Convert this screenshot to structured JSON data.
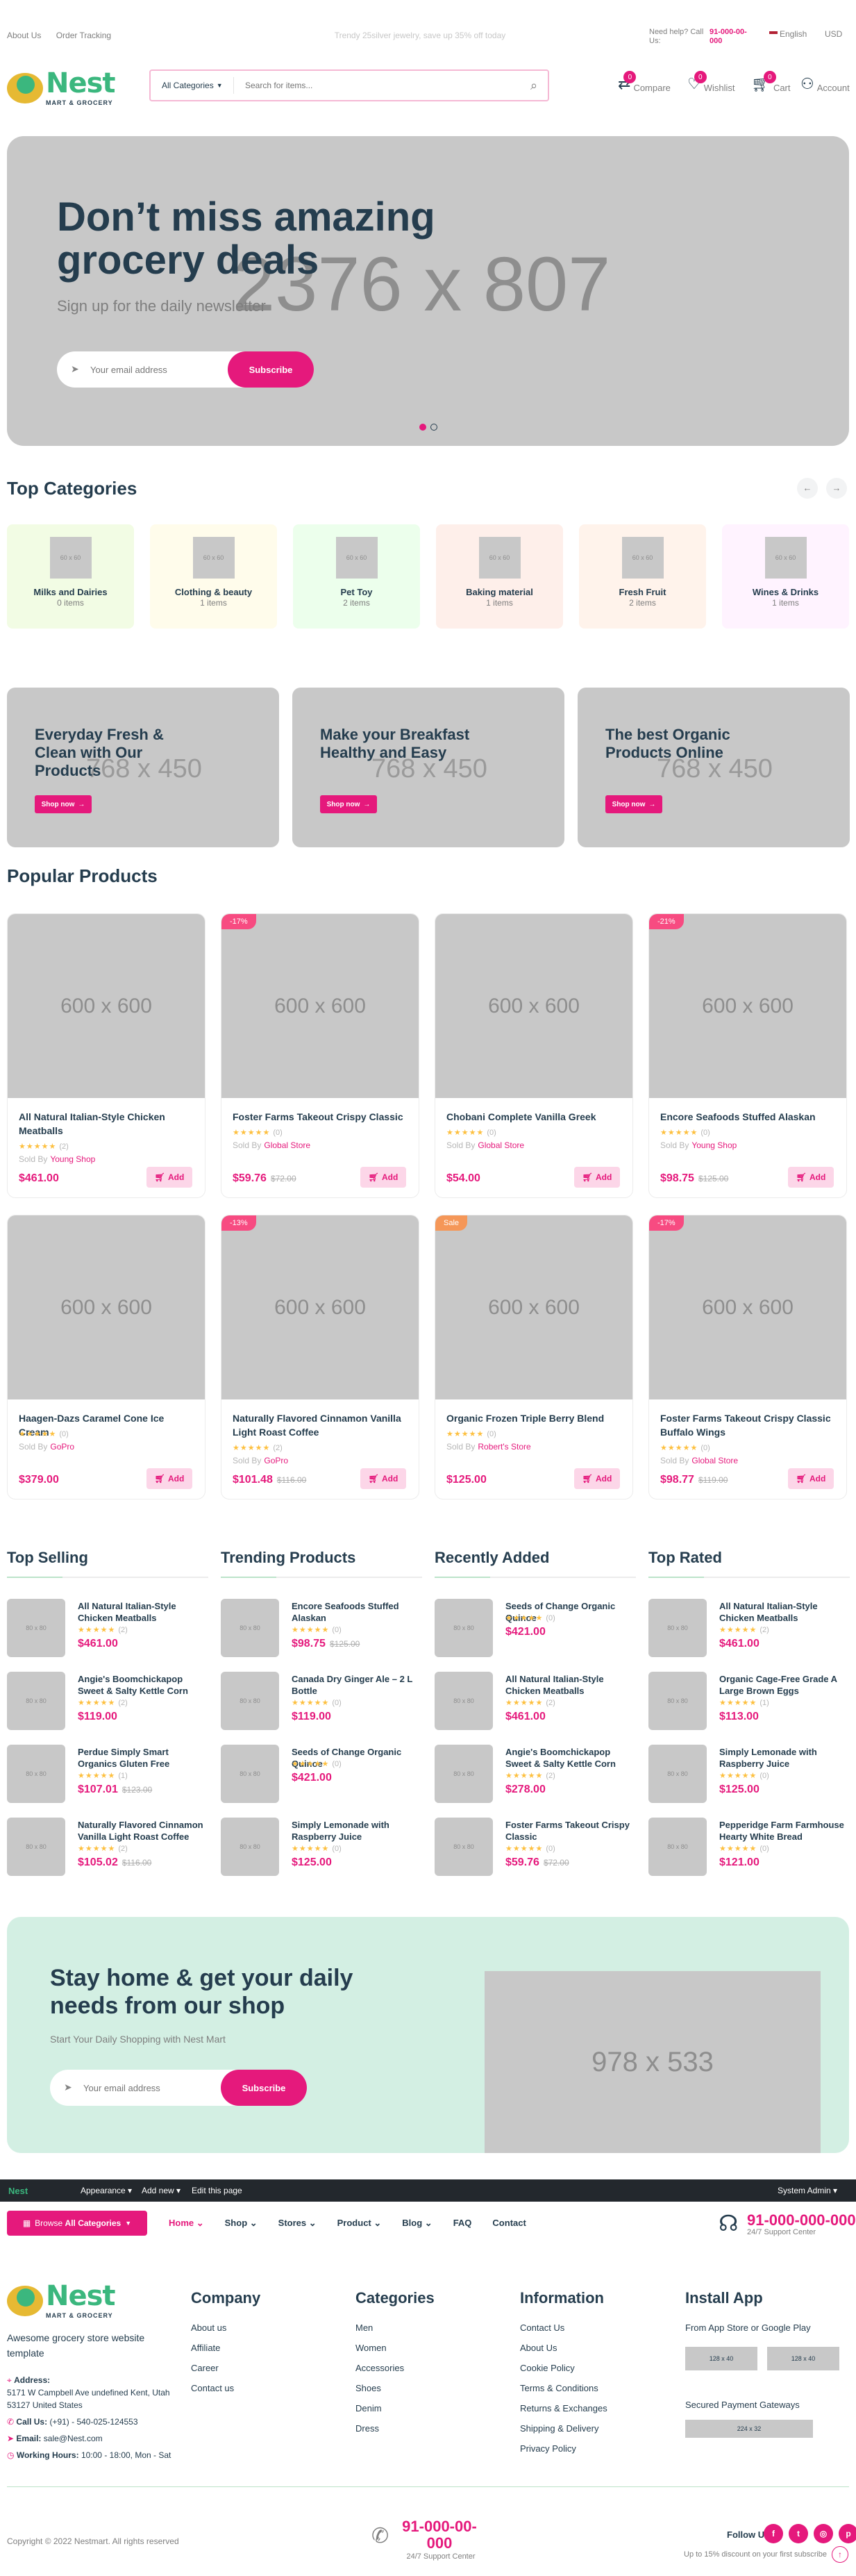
{
  "topbar": {
    "links": [
      "About Us",
      "Order Tracking"
    ],
    "promo": "Trendy 25silver jewelry, save up 35% off today",
    "help_label": "Need help? Call Us:",
    "help_phone": "91-000-00-000",
    "language": "English",
    "currency": "USD"
  },
  "header": {
    "logo_name": "Nest",
    "logo_tag": "MART & GROCERY",
    "category_select": "All Categories",
    "search_placeholder": "Search for items...",
    "compare": {
      "label": "Compare",
      "count": "0"
    },
    "wishlist": {
      "label": "Wishlist",
      "count": "0"
    },
    "cart": {
      "label": "Cart",
      "count": "0"
    },
    "account": "Account"
  },
  "hero": {
    "placeholder_text": "2376 x 807",
    "title_line1": "Don’t miss amazing",
    "title_line2": "grocery deals",
    "subtitle": "Sign up for the daily newsletter",
    "email_placeholder": "Your email address",
    "subscribe": "Subscribe"
  },
  "categories": {
    "title": "Top Categories",
    "items": [
      {
        "name": "Milks and Dairies",
        "count": "0 items",
        "bg": "#f2fce4",
        "ph": "60 x 60"
      },
      {
        "name": "Clothing & beauty",
        "count": "1 items",
        "bg": "#fffceb",
        "ph": "60 x 60"
      },
      {
        "name": "Pet Toy",
        "count": "2 items",
        "bg": "#ecffec",
        "ph": "60 x 60"
      },
      {
        "name": "Baking material",
        "count": "1 items",
        "bg": "#feefea",
        "ph": "60 x 60"
      },
      {
        "name": "Fresh Fruit",
        "count": "2 items",
        "bg": "#fff3eb",
        "ph": "60 x 60"
      },
      {
        "name": "Wines & Drinks",
        "count": "1 items",
        "bg": "#fff3ff",
        "ph": "60 x 60"
      }
    ]
  },
  "banners": [
    {
      "title": "Everyday Fresh & Clean with Our Products",
      "ph": "768 x 450",
      "cta": "Shop now"
    },
    {
      "title": "Make your Breakfast Healthy and Easy",
      "ph": "768 x 450",
      "cta": "Shop now"
    },
    {
      "title": "The best Organic Products Online",
      "ph": "768 x 450",
      "cta": "Shop now"
    }
  ],
  "popular": {
    "title": "Popular Products",
    "sold_by_label": "Sold By",
    "add_label": "Add",
    "products": [
      {
        "name": "All Natural Italian-Style Chicken Meatballs",
        "rating": "(2)",
        "vendor": "Young Shop",
        "price": "$461.00",
        "old": "",
        "tag": "",
        "tag_color": "",
        "ph": "600 x 600"
      },
      {
        "name": "Foster Farms Takeout Crispy Classic",
        "rating": "(0)",
        "vendor": "Global Store",
        "price": "$59.76",
        "old": "$72.00",
        "tag": "-17%",
        "tag_color": "#f74b81",
        "ph": "600 x 600"
      },
      {
        "name": "Chobani Complete Vanilla Greek",
        "rating": "(0)",
        "vendor": "Global Store",
        "price": "$54.00",
        "old": "",
        "tag": "",
        "tag_color": "",
        "ph": "600 x 600"
      },
      {
        "name": "Encore Seafoods Stuffed Alaskan",
        "rating": "(0)",
        "vendor": "Young Shop",
        "price": "$98.75",
        "old": "$125.00",
        "tag": "-21%",
        "tag_color": "#f74b81",
        "ph": "600 x 600"
      },
      {
        "name": "Haagen-Dazs Caramel Cone Ice Cream",
        "rating": "(0)",
        "vendor": "GoPro",
        "price": "$379.00",
        "old": "",
        "tag": "",
        "tag_color": "",
        "ph": "600 x 600"
      },
      {
        "name": "Naturally Flavored Cinnamon Vanilla Light Roast Coffee",
        "rating": "(2)",
        "vendor": "GoPro",
        "price": "$101.48",
        "old": "$116.00",
        "tag": "-13%",
        "tag_color": "#f74b81",
        "ph": "600 x 600"
      },
      {
        "name": "Organic Frozen Triple Berry Blend",
        "rating": "(0)",
        "vendor": "Robert's Store",
        "price": "$125.00",
        "old": "",
        "tag": "Sale",
        "tag_color": "#f59758",
        "ph": "600 x 600"
      },
      {
        "name": "Foster Farms Takeout Crispy Classic Buffalo Wings",
        "rating": "(0)",
        "vendor": "Global Store",
        "price": "$98.77",
        "old": "$119.00",
        "tag": "-17%",
        "tag_color": "#f74b81",
        "ph": "600 x 600"
      }
    ]
  },
  "lists": [
    {
      "title": "Top Selling",
      "items": [
        {
          "name": "All Natural Italian-Style Chicken Meatballs",
          "rating": "(2)",
          "price": "$461.00",
          "old": ""
        },
        {
          "name": "Angie's Boomchickapop Sweet & Salty Kettle Corn",
          "rating": "(2)",
          "price": "$119.00",
          "old": ""
        },
        {
          "name": "Perdue Simply Smart Organics Gluten Free",
          "rating": "(1)",
          "price": "$107.01",
          "old": "$123.00"
        },
        {
          "name": "Naturally Flavored Cinnamon Vanilla Light Roast Coffee",
          "rating": "(2)",
          "price": "$105.02",
          "old": "$116.00"
        }
      ]
    },
    {
      "title": "Trending Products",
      "items": [
        {
          "name": "Encore Seafoods Stuffed Alaskan",
          "rating": "(0)",
          "price": "$98.75",
          "old": "$125.00"
        },
        {
          "name": "Canada Dry Ginger Ale – 2 L Bottle",
          "rating": "(0)",
          "price": "$119.00",
          "old": ""
        },
        {
          "name": "Seeds of Change Organic Quinoe",
          "rating": "(0)",
          "price": "$421.00",
          "old": ""
        },
        {
          "name": "Simply Lemonade with Raspberry Juice",
          "rating": "(0)",
          "price": "$125.00",
          "old": ""
        }
      ]
    },
    {
      "title": "Recently Added",
      "items": [
        {
          "name": "Seeds of Change Organic Quinoe",
          "rating": "(0)",
          "price": "$421.00",
          "old": ""
        },
        {
          "name": "All Natural Italian-Style Chicken Meatballs",
          "rating": "(2)",
          "price": "$461.00",
          "old": ""
        },
        {
          "name": "Angie's Boomchickapop Sweet & Salty Kettle Corn",
          "rating": "(2)",
          "price": "$278.00",
          "old": ""
        },
        {
          "name": "Foster Farms Takeout Crispy Classic",
          "rating": "(0)",
          "price": "$59.76",
          "old": "$72.00"
        }
      ]
    },
    {
      "title": "Top Rated",
      "items": [
        {
          "name": "All Natural Italian-Style Chicken Meatballs",
          "rating": "(2)",
          "price": "$461.00",
          "old": ""
        },
        {
          "name": "Organic Cage-Free Grade A Large Brown Eggs",
          "rating": "(1)",
          "price": "$113.00",
          "old": ""
        },
        {
          "name": "Simply Lemonade with Raspberry Juice",
          "rating": "(0)",
          "price": "$125.00",
          "old": ""
        },
        {
          "name": "Pepperidge Farm Farmhouse Hearty White Bread",
          "rating": "(0)",
          "price": "$121.00",
          "old": ""
        }
      ]
    }
  ],
  "list_thumb": "80 x 80",
  "newsletter": {
    "title_line1": "Stay home & get your daily",
    "title_line2": "needs from our shop",
    "subtitle": "Start Your Daily Shopping with Nest Mart",
    "email_placeholder": "Your email address",
    "subscribe": "Subscribe",
    "ph": "978 x 533"
  },
  "adminbar": {
    "logo": "Nest",
    "items": [
      "Appearance",
      "Add new",
      "Edit this page"
    ],
    "user": "System Admin"
  },
  "mainnav": {
    "browse": "Browse",
    "browse_bold": "All Categories",
    "items": [
      "Home",
      "Shop",
      "Stores",
      "Product",
      "Blog",
      "FAQ",
      "Contact"
    ],
    "phone": "91-000-000-000",
    "phone_sub": "24/7 Support Center"
  },
  "footer": {
    "about": "Awesome grocery store website template",
    "address_label": "Address:",
    "address": "5171 W Campbell Ave undefined Kent, Utah 53127 United States",
    "call_label": "Call Us:",
    "call": "(+91) - 540-025-124553",
    "email_label": "Email:",
    "email": "sale@Nest.com",
    "hours_label": "Working Hours:",
    "hours": "10:00 - 18:00, Mon - Sat",
    "columns": [
      {
        "title": "Company",
        "links": [
          "About us",
          "Affiliate",
          "Career",
          "Contact us"
        ]
      },
      {
        "title": "Categories",
        "links": [
          "Men",
          "Women",
          "Accessories",
          "Shoes",
          "Denim",
          "Dress"
        ]
      },
      {
        "title": "Information",
        "links": [
          "Contact Us",
          "About Us",
          "Cookie Policy",
          "Terms & Conditions",
          "Returns & Exchanges",
          "Shipping & Delivery",
          "Privacy Policy"
        ]
      }
    ],
    "install_title": "Install App",
    "install_sub": "From App Store or Google Play",
    "store1": "128 x 40",
    "store2": "128 x 40",
    "payment_title": "Secured Payment Gateways",
    "payment_ph": "224 x 32",
    "copyright": "Copyright © 2022 Nestmart. All rights reserved",
    "bottom_phone": "91-000-00-000",
    "bottom_phone_sub": "24/7 Support Center",
    "follow": "Follow Us",
    "discount": "Up to 15% discount on your first subscribe"
  },
  "colors": {
    "brand": "#3bb77e",
    "accent": "#e5197c",
    "dark": "#253d4e"
  }
}
